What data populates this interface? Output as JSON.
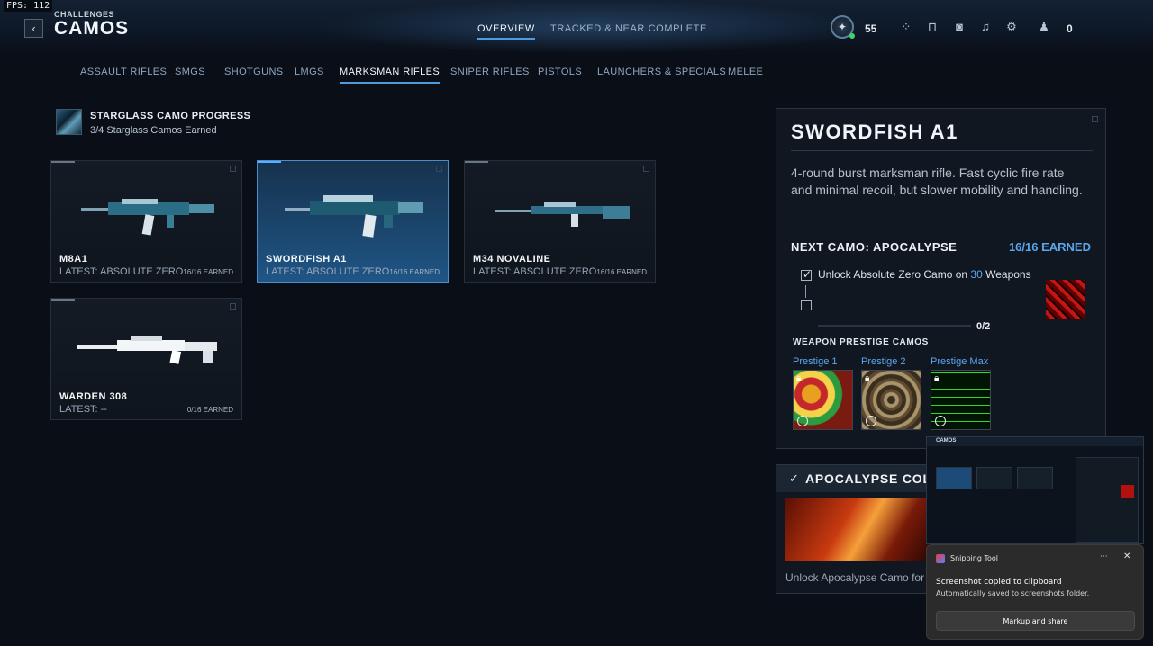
{
  "overlay": {
    "fps": "FPS: 112"
  },
  "header": {
    "breadcrumb": "CHALLENGES",
    "title": "CAMOS",
    "tabs": [
      {
        "label": "OVERVIEW",
        "active": true
      },
      {
        "label": "TRACKED & NEAR COMPLETE",
        "active": false
      }
    ],
    "rank_value": "55",
    "currency_value": "0"
  },
  "categories": [
    {
      "label": "ASSAULT RIFLES"
    },
    {
      "label": "SMGS"
    },
    {
      "label": "SHOTGUNS"
    },
    {
      "label": "LMGS"
    },
    {
      "label": "MARKSMAN RIFLES",
      "active": true
    },
    {
      "label": "SNIPER RIFLES"
    },
    {
      "label": "PISTOLS"
    },
    {
      "label": "LAUNCHERS & SPECIALS"
    },
    {
      "label": "MELEE"
    }
  ],
  "progress": {
    "title": "STARGLASS CAMO PROGRESS",
    "subtitle": "3/4 Starglass Camos Earned"
  },
  "weapons": [
    {
      "name": "M8A1",
      "latest": "LATEST: ABSOLUTE ZERO",
      "earned": "16/16 EARNED"
    },
    {
      "name": "SWORDFISH A1",
      "latest": "LATEST: ABSOLUTE ZERO",
      "earned": "16/16 EARNED",
      "selected": true
    },
    {
      "name": "M34 NOVALINE",
      "latest": "LATEST: ABSOLUTE ZERO",
      "earned": "16/16 EARNED"
    },
    {
      "name": "WARDEN 308",
      "latest": "LATEST: --",
      "earned": "0/16 EARNED"
    }
  ],
  "detail": {
    "title": "SWORDFISH A1",
    "description": "4-round burst marksman rifle. Fast cyclic fire rate and minimal recoil, but slower mobility and handling.",
    "next_camo": "NEXT CAMO: APOCALYPSE",
    "next_earned": "16/16 EARNED",
    "challenge_prefix": "Unlock Absolute Zero Camo on ",
    "challenge_number": "30",
    "challenge_suffix": " Weapons",
    "progress_label": "0/2",
    "progress_fraction": 0,
    "prestige_heading": "WEAPON PRESTIGE CAMOS",
    "prestige": [
      {
        "label": "Prestige 1"
      },
      {
        "label": "Prestige 2"
      },
      {
        "label": "Prestige Max"
      }
    ]
  },
  "collection": {
    "title": "APOCALYPSE COLLE",
    "subtitle": "Unlock Apocalypse Camo for any"
  },
  "snipping_toast": {
    "app": "Snipping Tool",
    "heading": "Screenshot copied to clipboard",
    "body": "Automatically saved to screenshots folder.",
    "button": "Markup and share",
    "more": "···",
    "preview_title": "CAMOS"
  },
  "colors": {
    "accent": "#4e9be0",
    "accent_text": "#5aa6ef",
    "background": "#0a0f17"
  },
  "icons": [
    "back-icon",
    "rank-icon",
    "grid-icon",
    "lock-icon",
    "camera-icon",
    "bell-icon",
    "gear-icon",
    "party-icon",
    "check-icon",
    "close-icon"
  ]
}
